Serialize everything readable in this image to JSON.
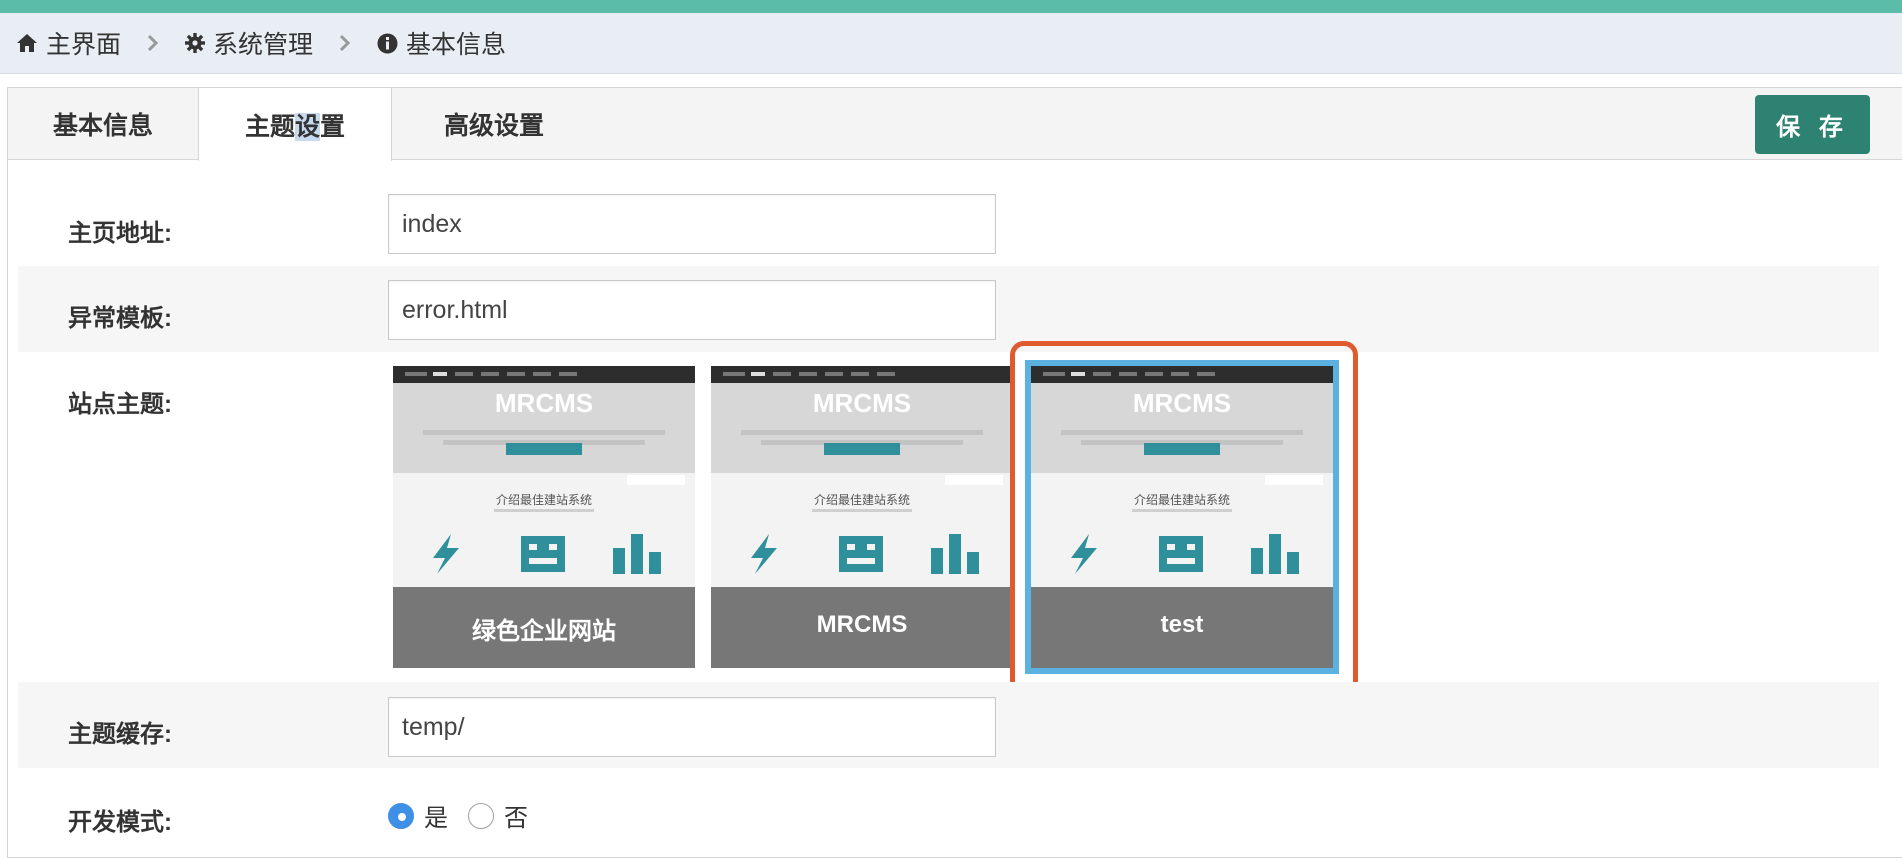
{
  "colors": {
    "top_strip": "#5bbca9",
    "save_button": "#2e8272",
    "highlight_box": "#e05a2d",
    "selected_theme_border": "#5bb2e1",
    "radio_checked": "#3f8fe6",
    "theme_accent": "#2f8f9a"
  },
  "breadcrumb": {
    "items": [
      {
        "label": "主界面",
        "icon": "home-icon"
      },
      {
        "label": "系统管理",
        "icon": "gear-icon"
      },
      {
        "label": "基本信息",
        "icon": "info-circle-icon"
      }
    ],
    "separator_icon": "chevron-right-icon"
  },
  "tabs": [
    {
      "label": "基本信息",
      "active": false
    },
    {
      "label_before": "主题",
      "label_selected": "设",
      "label_after": "置",
      "active": true
    },
    {
      "label": "高级设置",
      "active": false
    }
  ],
  "save_label": "保 存",
  "form": {
    "homepage": {
      "label": "主页地址:",
      "value": "index"
    },
    "error_template": {
      "label": "异常模板:",
      "value": "error.html"
    },
    "site_theme": {
      "label": "站点主题:",
      "themes": [
        {
          "name": "绿色企业网站",
          "brand": "MRCMS",
          "subtitle": "介绍最佳建站系统",
          "selected": false
        },
        {
          "name": "MRCMS",
          "brand": "MRCMS",
          "subtitle": "介绍最佳建站系统",
          "selected": false
        },
        {
          "name": "test",
          "brand": "MRCMS",
          "subtitle": "介绍最佳建站系统",
          "selected": true
        }
      ]
    },
    "theme_cache": {
      "label": "主题缓存:",
      "value": "temp/"
    },
    "dev_mode": {
      "label": "开发模式:",
      "options": [
        {
          "label": "是",
          "checked": true
        },
        {
          "label": "否",
          "checked": false
        }
      ]
    }
  }
}
